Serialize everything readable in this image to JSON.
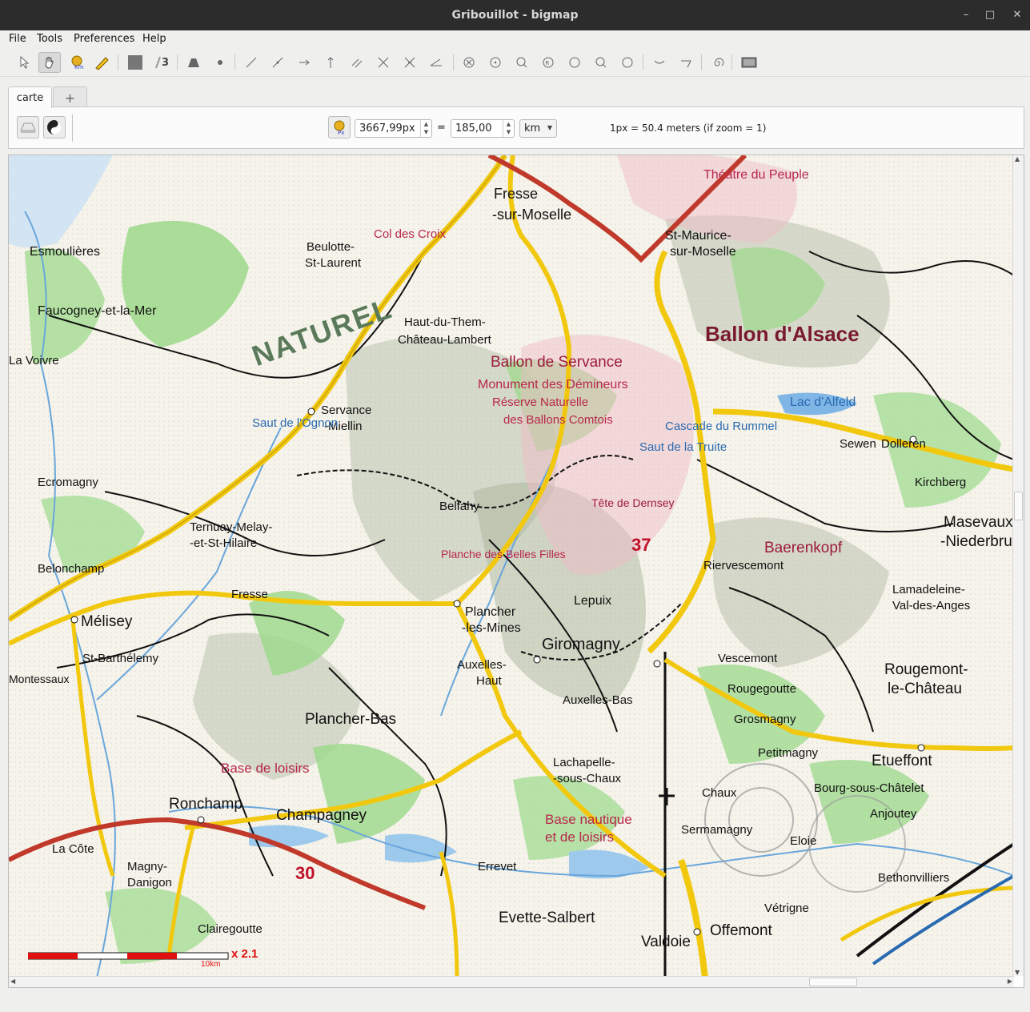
{
  "window": {
    "title": "Gribouillot - bigmap",
    "minimize": "–",
    "maximize": "□",
    "close": "✕"
  },
  "menu": {
    "file": "File",
    "tools": "Tools",
    "preferences": "Preferences",
    "help": "Help"
  },
  "tabs": {
    "active": "carte",
    "add": "+"
  },
  "scale_panel": {
    "pixels_value": "3667,99px",
    "equals": "=",
    "distance_value": "185,00",
    "unit": "km",
    "info": "1px = 50.4 meters (if zoom = 1)"
  },
  "map": {
    "labels": [
      {
        "t": "Fresse",
        "c": "#111",
        "s": 18
      },
      {
        "t": "-sur-Moselle",
        "c": "#111",
        "s": 18
      },
      {
        "t": "St-Maurice-",
        "c": "#111",
        "s": 16
      },
      {
        "t": "sur-Moselle",
        "c": "#111",
        "s": 16
      },
      {
        "t": "Ballon d'Alsace",
        "c": "#7a1a2e",
        "s": 26
      },
      {
        "t": "Ballon de Servance",
        "c": "#9c1b3b",
        "s": 19
      },
      {
        "t": "Monument des Démineurs",
        "c": "#b8264a",
        "s": 16
      },
      {
        "t": "Réserve Naturelle",
        "c": "#b8264a",
        "s": 15
      },
      {
        "t": "des Ballons Comtois",
        "c": "#b8264a",
        "s": 15
      },
      {
        "t": "NATUREL",
        "c": "#5a7a5a",
        "s": 36
      },
      {
        "t": "Servance",
        "c": "#111",
        "s": 15
      },
      {
        "t": "-Miellin",
        "c": "#111",
        "s": 15
      },
      {
        "t": "Haut-du-Them-",
        "c": "#111",
        "s": 15
      },
      {
        "t": "Château-Lambert",
        "c": "#111",
        "s": 15
      },
      {
        "t": "Faucogney-et-la-Mer",
        "c": "#111",
        "s": 16
      },
      {
        "t": "Esmoulières",
        "c": "#111",
        "s": 16
      },
      {
        "t": "Beulotte-",
        "c": "#111",
        "s": 15
      },
      {
        "t": "St-Laurent",
        "c": "#111",
        "s": 15
      },
      {
        "t": "Ternuay-Melay-",
        "c": "#111",
        "s": 15
      },
      {
        "t": "-et-St-Hilaire",
        "c": "#111",
        "s": 15
      },
      {
        "t": "Mélisey",
        "c": "#111",
        "s": 19
      },
      {
        "t": "Belonchamp",
        "c": "#111",
        "s": 15
      },
      {
        "t": "St-Barthélemy",
        "c": "#111",
        "s": 15
      },
      {
        "t": "Plancher",
        "c": "#111",
        "s": 16
      },
      {
        "t": "-les-Mines",
        "c": "#111",
        "s": 16
      },
      {
        "t": "Plancher-Bas",
        "c": "#111",
        "s": 19
      },
      {
        "t": "Giromagny",
        "c": "#111",
        "s": 20
      },
      {
        "t": "Lepuix",
        "c": "#111",
        "s": 16
      },
      {
        "t": "Auxelles-",
        "c": "#111",
        "s": 15
      },
      {
        "t": "Haut",
        "c": "#111",
        "s": 15
      },
      {
        "t": "Auxelles-Bas",
        "c": "#111",
        "s": 15
      },
      {
        "t": "Vescemont",
        "c": "#111",
        "s": 15
      },
      {
        "t": "Rougegoutte",
        "c": "#111",
        "s": 15
      },
      {
        "t": "Grosmagny",
        "c": "#111",
        "s": 15
      },
      {
        "t": "Petitmagny",
        "c": "#111",
        "s": 15
      },
      {
        "t": "Etueffont",
        "c": "#111",
        "s": 19
      },
      {
        "t": "Rougemont-",
        "c": "#111",
        "s": 19
      },
      {
        "t": "le-Château",
        "c": "#111",
        "s": 19
      },
      {
        "t": "Lamadeleine-",
        "c": "#111",
        "s": 15
      },
      {
        "t": "Val-des-Anges",
        "c": "#111",
        "s": 15
      },
      {
        "t": "Riervescemont",
        "c": "#111",
        "s": 15
      },
      {
        "t": "Baerenkopf",
        "c": "#9c1b3b",
        "s": 19
      },
      {
        "t": "Sewen",
        "c": "#111",
        "s": 15
      },
      {
        "t": "Dolleren",
        "c": "#111",
        "s": 15
      },
      {
        "t": "Kirchberg",
        "c": "#111",
        "s": 15
      },
      {
        "t": "Masevaux",
        "c": "#111",
        "s": 19
      },
      {
        "t": "-Niederbruck",
        "c": "#111",
        "s": 19
      },
      {
        "t": "Lachapelle-",
        "c": "#111",
        "s": 15
      },
      {
        "t": "-sous-Chaux",
        "c": "#111",
        "s": 15
      },
      {
        "t": "Chaux",
        "c": "#111",
        "s": 15
      },
      {
        "t": "Sermamagny",
        "c": "#111",
        "s": 15
      },
      {
        "t": "Ronchamp",
        "c": "#111",
        "s": 19
      },
      {
        "t": "Champagney",
        "c": "#111",
        "s": 19
      },
      {
        "t": "Base de loisirs",
        "c": "#b8264a",
        "s": 17
      },
      {
        "t": "Base nautique",
        "c": "#b8264a",
        "s": 17
      },
      {
        "t": "et de loisirs",
        "c": "#b8264a",
        "s": 17
      },
      {
        "t": "Errevet",
        "c": "#111",
        "s": 15
      },
      {
        "t": "Evette-Salbert",
        "c": "#111",
        "s": 19
      },
      {
        "t": "Offemont",
        "c": "#111",
        "s": 19
      },
      {
        "t": "Valdoie",
        "c": "#111",
        "s": 19
      },
      {
        "t": "Vétrigne",
        "c": "#111",
        "s": 15
      },
      {
        "t": "Eloie",
        "c": "#111",
        "s": 15
      },
      {
        "t": "Anjoutey",
        "c": "#111",
        "s": 15
      },
      {
        "t": "Bethonvilliers",
        "c": "#111",
        "s": 15
      },
      {
        "t": "Bourg-sous-Châtelet",
        "c": "#111",
        "s": 15
      },
      {
        "t": "Magny-",
        "c": "#111",
        "s": 15
      },
      {
        "t": "Danigon",
        "c": "#111",
        "s": 15
      },
      {
        "t": "La Côte",
        "c": "#111",
        "s": 15
      },
      {
        "t": "Clairegoutte",
        "c": "#111",
        "s": 15
      },
      {
        "t": "Ecromagny",
        "c": "#111",
        "s": 15
      },
      {
        "t": "Fresse",
        "c": "#111",
        "s": 15
      },
      {
        "t": "La Voivre",
        "c": "#111",
        "s": 15
      },
      {
        "t": "Montessaux",
        "c": "#111",
        "s": 14
      },
      {
        "t": "Belfahy",
        "c": "#111",
        "s": 15
      },
      {
        "t": "Saut de la Truite",
        "c": "#2a6ab0",
        "s": 15
      },
      {
        "t": "Lac d'Alfeld",
        "c": "#2a6ab0",
        "s": 16
      },
      {
        "t": "Cascade du Rummel",
        "c": "#2a6ab0",
        "s": 15
      },
      {
        "t": "Saut de l'Ognon",
        "c": "#2a6ab0",
        "s": 15
      },
      {
        "t": "Planche des Belles Filles",
        "c": "#b8264a",
        "s": 14
      },
      {
        "t": "Tête de Dernsey",
        "c": "#9c1b3b",
        "s": 14
      },
      {
        "t": "Col des Croix",
        "c": "#b8264a",
        "s": 15
      },
      {
        "t": "37",
        "c": "#c0102a",
        "s": 22
      },
      {
        "t": "30",
        "c": "#c0102a",
        "s": 22
      },
      {
        "t": "Théâtre du Peuple",
        "c": "#b8264a",
        "s": 16
      }
    ],
    "scalebar": {
      "label": "x 2.1",
      "unit_label": "10km"
    }
  },
  "colors": {
    "titlebar": "#2c2c2c",
    "road_main": "#f2c80f",
    "road_red": "#c0392b",
    "forest": "#9bd88a",
    "water": "#7fb6e6",
    "pink_zone": "#f1b8c8"
  }
}
